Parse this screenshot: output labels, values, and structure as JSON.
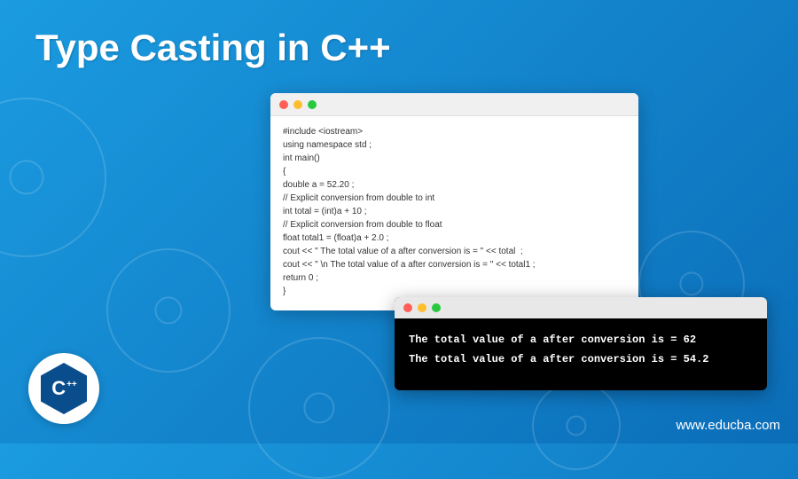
{
  "title": "Type Casting in C++",
  "code": {
    "lines": [
      "#include <iostream>",
      "using namespace std ;",
      "int main()",
      "{",
      "double a = 52.20 ;",
      "// Explicit conversion from double to int",
      "int total = (int)a + 10 ;",
      "// Explicit conversion from double to float",
      "float total1 = (float)a + 2.0 ;",
      "cout << \" The total value of a after conversion is = \" << total  ;",
      "cout << \" \\n The total value of a after conversion is = \" << total1 ;",
      "return 0 ;",
      "}"
    ]
  },
  "terminal": {
    "lines": [
      "The total value of a after conversion is = 62",
      "The total value of a after conversion is = 54.2"
    ]
  },
  "logo_text": "C",
  "logo_plus": "++",
  "url": "www.educba.com"
}
